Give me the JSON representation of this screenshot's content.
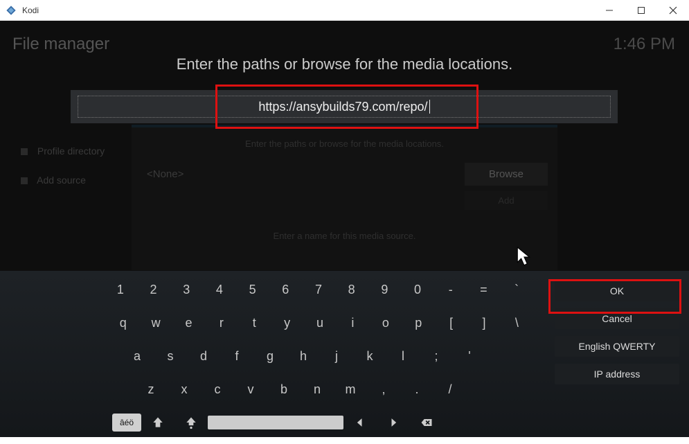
{
  "window": {
    "title": "Kodi"
  },
  "header": {
    "title": "File manager",
    "clock": "1:46 PM"
  },
  "sidebar": {
    "items": [
      {
        "label": "Profile directory"
      },
      {
        "label": "Add source"
      }
    ]
  },
  "dialog": {
    "prompt": "Enter the paths or browse for the media locations.",
    "input_value": "https://ansybuilds79.com/repo/"
  },
  "bg_dialog": {
    "prompt": "Enter the paths or browse for the media locations.",
    "none": "<None>",
    "browse": "Browse",
    "add": "Add",
    "name_prompt": "Enter a name for this media source."
  },
  "keyboard": {
    "row1": [
      "1",
      "2",
      "3",
      "4",
      "5",
      "6",
      "7",
      "8",
      "9",
      "0",
      "-",
      "=",
      "`"
    ],
    "row2": [
      "q",
      "w",
      "e",
      "r",
      "t",
      "y",
      "u",
      "i",
      "o",
      "p",
      "[",
      "]",
      "\\"
    ],
    "row3": [
      "a",
      "s",
      "d",
      "f",
      "g",
      "h",
      "j",
      "k",
      "l",
      ";",
      "'"
    ],
    "row4": [
      "z",
      "x",
      "c",
      "v",
      "b",
      "n",
      "m",
      ",",
      ".",
      "/"
    ],
    "symkey": "âéö",
    "side": {
      "ok": "OK",
      "cancel": "Cancel",
      "layout": "English QWERTY",
      "ip": "IP address"
    }
  }
}
